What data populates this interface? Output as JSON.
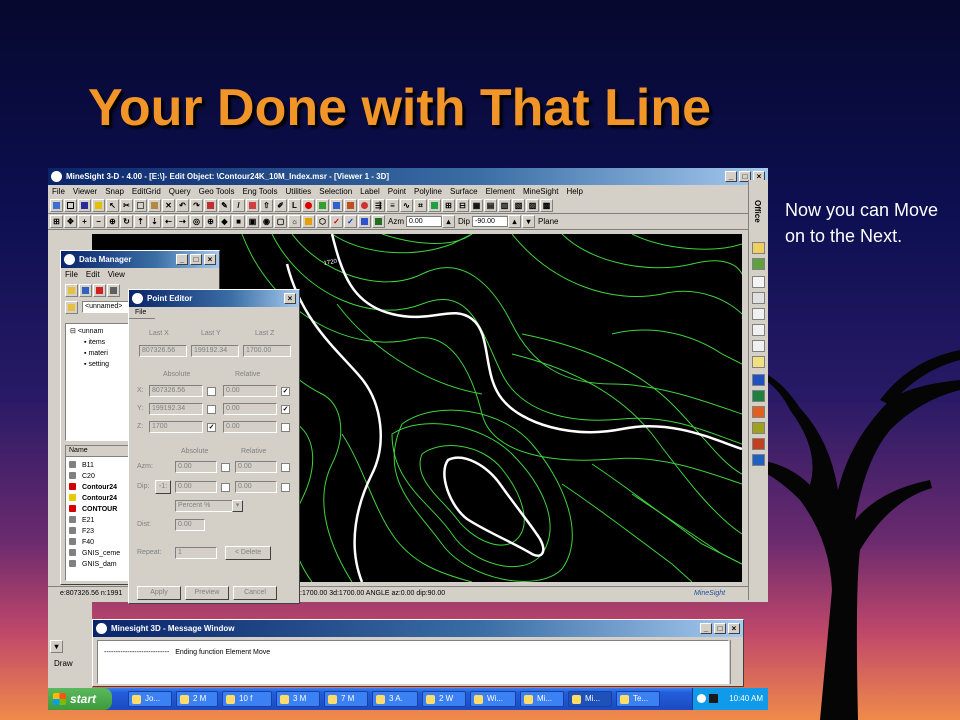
{
  "slide": {
    "title": "Your Done with That Line",
    "note": "Now you can Move on to the Next."
  },
  "app": {
    "title": "MineSight 3-D - 4.00 - [E:\\]- Edit Object: \\Contour24K_10M_Index.msr - [Viewer 1 - 3D]",
    "menus": [
      "File",
      "Viewer",
      "Snap",
      "EditGrid",
      "Query",
      "Geo Tools",
      "Eng Tools",
      "Utilities",
      "Selection",
      "Label",
      "Point",
      "Polyline",
      "Surface",
      "Element",
      "MineSight",
      "Help"
    ],
    "azm_label": "Azm",
    "azm_value": "0.00",
    "dip_label": "Dip",
    "dip_value": "-90.00",
    "plane_label": "Plane",
    "contour_label": "1720",
    "status": {
      "coords": "e:807326.56  n:1991",
      "coords2": ":1700.00  3d:1700.00   ANGLE  az:0.00  dip:90.00",
      "brand": "MineSight"
    },
    "office_label": "Office"
  },
  "data_manager": {
    "title": "Data Manager",
    "menus": [
      "File",
      "Edit",
      "View"
    ],
    "unnamed_combo": "<unnamed>",
    "tree": [
      {
        "label": "<unnam",
        "level": 0
      },
      {
        "label": "items",
        "level": 1
      },
      {
        "label": "materi",
        "level": 1
      },
      {
        "label": "setting",
        "level": 1
      }
    ],
    "list_header": "Name",
    "items": [
      {
        "label": "B11",
        "bold": false,
        "color": "#808080"
      },
      {
        "label": "C20",
        "bold": false,
        "color": "#808080"
      },
      {
        "label": "Contour24",
        "bold": true,
        "color": "#d40000"
      },
      {
        "label": "Contour24",
        "bold": true,
        "color": "#e8c800"
      },
      {
        "label": "CONTOUR",
        "bold": true,
        "color": "#d40000"
      },
      {
        "label": "E21",
        "bold": false,
        "color": "#808080"
      },
      {
        "label": "F23",
        "bold": false,
        "color": "#808080"
      },
      {
        "label": "F40",
        "bold": false,
        "color": "#808080"
      },
      {
        "label": "GNIS_ceme",
        "bold": false,
        "color": "#808080"
      },
      {
        "label": "GNIS_dam",
        "bold": false,
        "color": "#808080"
      }
    ]
  },
  "point_editor": {
    "title": "Point Editor",
    "menu": "File",
    "last_x_label": "Last X",
    "last_y_label": "Last Y",
    "last_z_label": "Last Z",
    "last_x": "807326.56",
    "last_y": "199192.34",
    "last_z": "1700.00",
    "absolute_label": "Absolute",
    "relative_label": "Relative",
    "x_label": "X:",
    "y_label": "Y:",
    "z_label": "Z:",
    "x_abs": "807326.56",
    "y_abs": "199192.34",
    "z_abs": "1700",
    "x_rel": "0.00",
    "y_rel": "0.00",
    "z_rel": "0.00",
    "azm_label": "Azm:",
    "dip_label": "Dip:",
    "azm_abs": "0.00",
    "azm_rel": "0.00",
    "dip_abs": "0.00",
    "dip_rel": "0.00",
    "dip_button": "-1:",
    "percent_option": "Percent %",
    "dist_label": "Dist:",
    "dist_value": "0.00",
    "repeat_label": "Repeat:",
    "repeat_value": "1",
    "delete_button": "< Delete",
    "apply_button": "Apply",
    "preview_button": "Preview",
    "cancel_button": "Cancel"
  },
  "message_window": {
    "title": "Minesight 3D - Message Window",
    "message_prefix": "----------------------------",
    "message": "Ending function Element Move"
  },
  "lower_left": {
    "draw_label": "Draw"
  },
  "taskbar": {
    "start": "start",
    "tasks": [
      "Jo...",
      "2 M",
      "10 f",
      "3 M",
      "7 M",
      "3 A.",
      "2 W",
      "Wi...",
      "Mi...",
      "Mi...",
      "Te..."
    ],
    "clock": "10:40 AM"
  },
  "colors": {
    "title": "#f19528",
    "contour_green": "#3fd23f",
    "selected_line": "#ffffff",
    "viewport_bg": "#000000"
  }
}
